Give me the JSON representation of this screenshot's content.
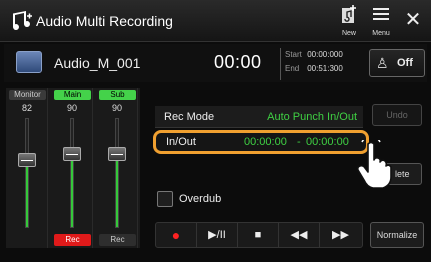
{
  "header": {
    "title": "Audio Multi Recording",
    "new_label": "New",
    "menu_label": "Menu",
    "close_glyph": "✕"
  },
  "file": {
    "name": "Audio_M_001",
    "time": "00:00",
    "start_label": "Start",
    "start_value": "00:00:000",
    "end_label": "End",
    "end_value": "00:51:300",
    "metronome_label": "Off"
  },
  "mixer": {
    "channels": [
      {
        "tag": "Monitor",
        "value": "82",
        "rec": "",
        "level": 0.82
      },
      {
        "tag": "Main",
        "value": "90",
        "rec": "Rec",
        "level": 0.9
      },
      {
        "tag": "Sub",
        "value": "90",
        "rec": "Rec",
        "level": 0.9
      }
    ]
  },
  "rec_mode": {
    "label": "Rec Mode",
    "value": "Auto Punch In/Out"
  },
  "inout": {
    "label": "In/Out",
    "in_value": "00:00:00",
    "separator": "-",
    "out_value": "00:00:00"
  },
  "buttons": {
    "undo": "Undo",
    "delete": "lete",
    "overdub": "Overdub",
    "normalize": "Normalize"
  },
  "transport": {
    "rec_glyph": "●",
    "play_pause_glyph": "▶/II",
    "stop_glyph": "■",
    "rewind_glyph": "◀◀",
    "forward_glyph": "▶▶"
  },
  "colors": {
    "accent_green": "#3fd043",
    "highlight_orange": "#f0a030",
    "rec_red": "#e01a1a"
  }
}
